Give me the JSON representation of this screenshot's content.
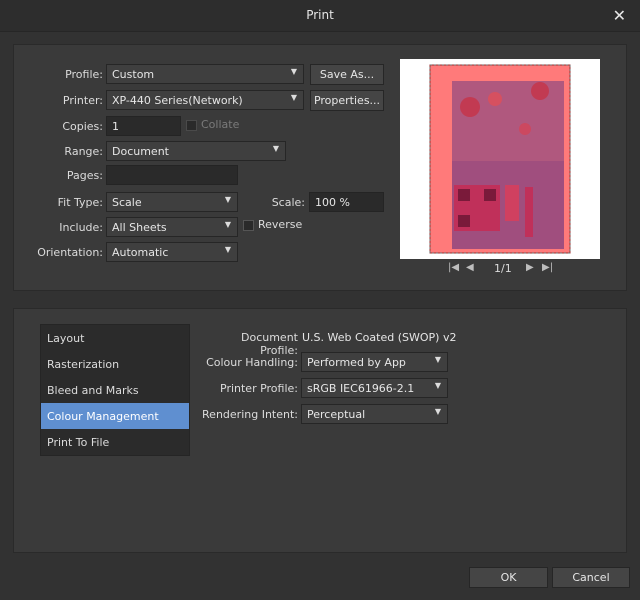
{
  "window": {
    "title": "Print",
    "close_glyph": "✕"
  },
  "form": {
    "profile_label": "Profile:",
    "profile_value": "Custom",
    "save_as_label": "Save As...",
    "printer_label": "Printer:",
    "printer_value": "XP-440 Series(Network)",
    "properties_label": "Properties...",
    "copies_label": "Copies:",
    "copies_value": "1",
    "collate_label": "Collate",
    "range_label": "Range:",
    "range_value": "Document",
    "pages_label": "Pages:",
    "pages_value": "",
    "fit_type_label": "Fit Type:",
    "fit_type_value": "Scale",
    "scale_label": "Scale:",
    "scale_value": "100 %",
    "include_label": "Include:",
    "include_value": "All Sheets",
    "reverse_label": "Reverse",
    "orientation_label": "Orientation:",
    "orientation_value": "Automatic"
  },
  "preview": {
    "page_indicator": "1/1"
  },
  "sidebar": {
    "items": [
      {
        "label": "Layout"
      },
      {
        "label": "Rasterization"
      },
      {
        "label": "Bleed and Marks"
      },
      {
        "label": "Colour Management",
        "selected": true
      },
      {
        "label": "Print To File"
      }
    ]
  },
  "colour": {
    "document_profile_label": "Document Profile:",
    "document_profile_value": "U.S. Web Coated (SWOP) v2",
    "colour_handling_label": "Colour Handling:",
    "colour_handling_value": "Performed by App",
    "printer_profile_label": "Printer Profile:",
    "printer_profile_value": "sRGB IEC61966-2.1",
    "rendering_intent_label": "Rendering Intent:",
    "rendering_intent_value": "Perceptual"
  },
  "footer": {
    "ok_label": "OK",
    "cancel_label": "Cancel"
  },
  "colors": {
    "selection": "#5f8fd0",
    "background": "#323232",
    "panel": "#3a3a3a"
  }
}
